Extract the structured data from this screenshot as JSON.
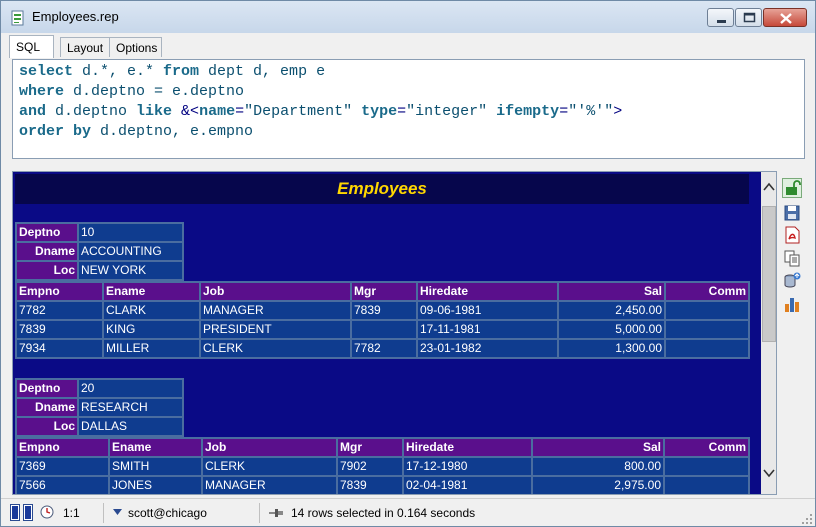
{
  "window": {
    "title": "Employees.rep",
    "minimize_icon": "minimize-icon",
    "maximize_icon": "maximize-icon",
    "close_icon": "close-icon"
  },
  "tabs": [
    {
      "label": "SQL",
      "active": true
    },
    {
      "label": "Layout",
      "active": false
    },
    {
      "label": "Options",
      "active": false
    }
  ],
  "sql": {
    "line1": {
      "kw1": "select",
      "t1": " d.*, e.* ",
      "kw2": "from",
      "t2": " dept d, emp e"
    },
    "line2": {
      "kw1": "where",
      "t1": " d.deptno = e.deptno"
    },
    "line3": {
      "kw1": "and",
      "t1": " d.deptno ",
      "kw2": "like",
      "op": " &<",
      "a1": "name",
      "e1": "=",
      "s1": "\"Department\"",
      "a2": " type",
      "e2": "=",
      "s2": "\"integer\"",
      "a3": " ifempty",
      "e3": "=",
      "s3": "\"'%'\"",
      "close": ">"
    },
    "line4": {
      "kw1": "order by",
      "t1": " d.deptno, e.empno"
    }
  },
  "report": {
    "title": "Employees",
    "colors": {
      "background": "#0a0a86",
      "header": "#5a0f8c",
      "cell": "#0f3c8f",
      "title": "#ffd800"
    },
    "groups": [
      {
        "labels": {
          "deptno": "Deptno",
          "dname": "Dname",
          "loc": "Loc"
        },
        "deptno": "10",
        "dname": "ACCOUNTING",
        "loc": "NEW YORK",
        "columns": [
          "Empno",
          "Ename",
          "Job",
          "Mgr",
          "Hiredate",
          "Sal",
          "Comm"
        ],
        "rows": [
          [
            "7782",
            "CLARK",
            "MANAGER",
            "7839",
            "09-06-1981",
            "2,450.00",
            ""
          ],
          [
            "7839",
            "KING",
            "PRESIDENT",
            "",
            "17-11-1981",
            "5,000.00",
            ""
          ],
          [
            "7934",
            "MILLER",
            "CLERK",
            "7782",
            "23-01-1982",
            "1,300.00",
            ""
          ]
        ]
      },
      {
        "labels": {
          "deptno": "Deptno",
          "dname": "Dname",
          "loc": "Loc"
        },
        "deptno": "20",
        "dname": "RESEARCH",
        "loc": "DALLAS",
        "columns": [
          "Empno",
          "Ename",
          "Job",
          "Mgr",
          "Hiredate",
          "Sal",
          "Comm"
        ],
        "rows": [
          [
            "7369",
            "SMITH",
            "CLERK",
            "7902",
            "17-12-1980",
            "800.00",
            ""
          ],
          [
            "7566",
            "JONES",
            "MANAGER",
            "7839",
            "02-04-1981",
            "2,975.00",
            ""
          ]
        ]
      }
    ]
  },
  "side_toolbar": [
    "lock-open-icon",
    "save-icon",
    "pdf-icon",
    "copy-icon",
    "export-db-icon",
    "chart-icon"
  ],
  "status": {
    "cursor": "1:1",
    "connection": "scott@chicago",
    "message": "14 rows selected in 0.164 seconds"
  }
}
